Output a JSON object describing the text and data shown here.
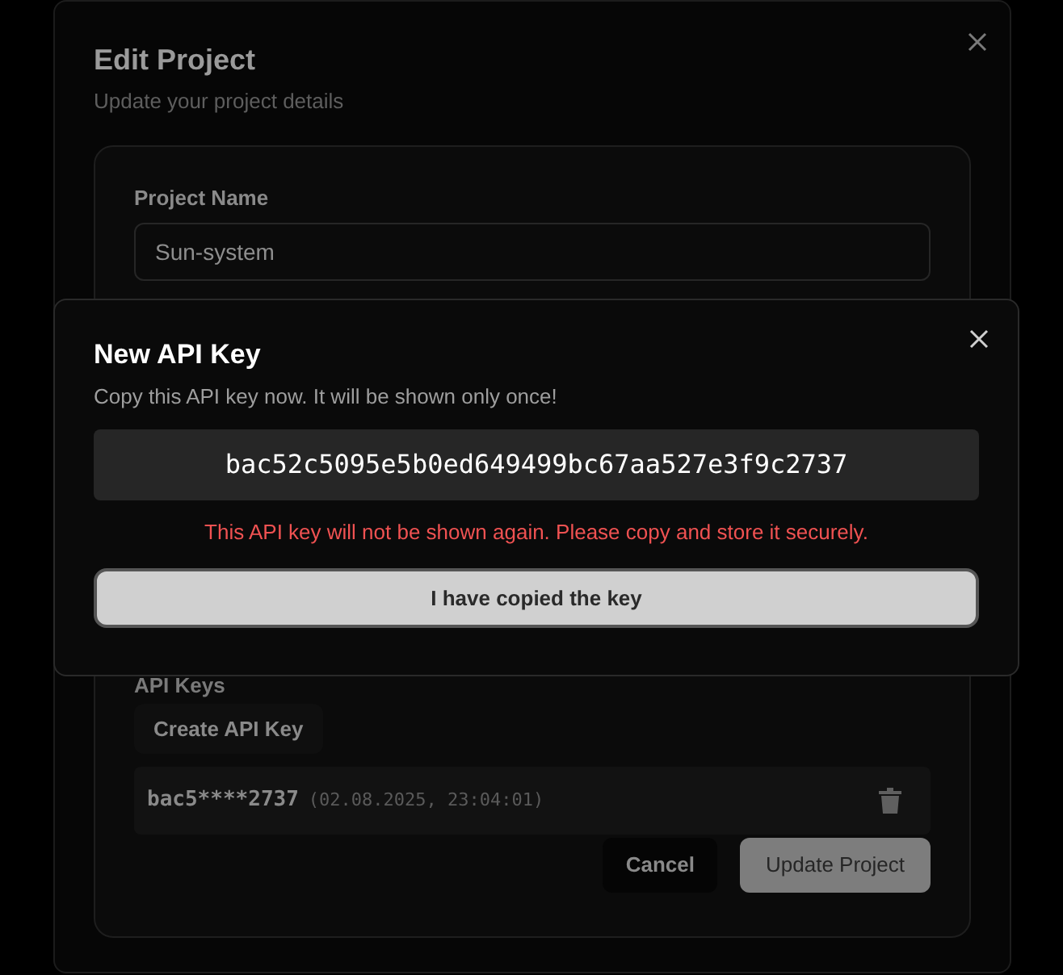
{
  "edit_dialog": {
    "title": "Edit Project",
    "subtitle": "Update your project details",
    "project_name": {
      "label": "Project Name",
      "value": "Sun-system"
    },
    "api_keys": {
      "label": "API Keys",
      "create_button": "Create API Key",
      "keys": [
        {
          "masked_key": "bac5****2737",
          "created": "(02.08.2025, 23:04:01)"
        }
      ]
    },
    "buttons": [
      {
        "label": "Cancel",
        "kind": "secondary"
      },
      {
        "label": "Update Project",
        "kind": "primary"
      }
    ]
  },
  "key_dialog": {
    "title": "New API Key",
    "subtitle": "Copy this API key now. It will be shown only once!",
    "key": "bac52c5095e5b0ed649499bc67aa527e3f9c2737",
    "warning": "This API key will not be shown again. Please copy and store it securely.",
    "button": "I have copied the key"
  }
}
